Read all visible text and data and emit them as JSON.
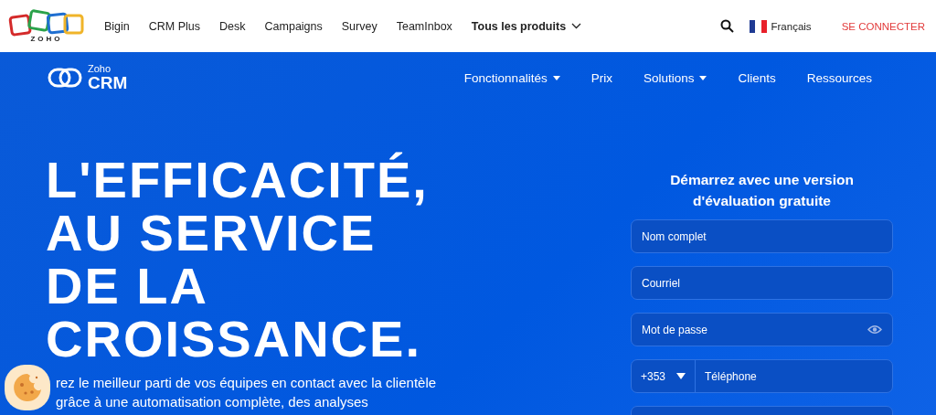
{
  "top_bar": {
    "logo": {
      "wordmark": "ZOHO"
    },
    "products": [
      {
        "label": "Bigin",
        "bold": false,
        "dropdown": false
      },
      {
        "label": "CRM Plus",
        "bold": false,
        "dropdown": false
      },
      {
        "label": "Desk",
        "bold": false,
        "dropdown": false
      },
      {
        "label": "Campaigns",
        "bold": false,
        "dropdown": false
      },
      {
        "label": "Survey",
        "bold": false,
        "dropdown": false
      },
      {
        "label": "TeamInbox",
        "bold": false,
        "dropdown": false
      },
      {
        "label": "Tous les produits",
        "bold": true,
        "dropdown": true
      }
    ],
    "language": "Français",
    "sign_in": "SE CONNECTER"
  },
  "header": {
    "logo": {
      "brand": "Zoho",
      "product": "CRM"
    },
    "menu": [
      {
        "label": "Fonctionnalités",
        "dropdown": true
      },
      {
        "label": "Prix",
        "dropdown": false
      },
      {
        "label": "Solutions",
        "dropdown": true
      },
      {
        "label": "Clients",
        "dropdown": false
      },
      {
        "label": "Ressources",
        "dropdown": false
      }
    ]
  },
  "hero": {
    "headline": [
      "L'EFFICACITÉ,",
      "AU SERVICE",
      "DE LA",
      "CROISSANCE."
    ],
    "lines": [
      "rez le meilleur parti de vos équipes en contact avec la clientèle",
      "grâce à une automatisation complète, des analyses"
    ]
  },
  "signup": {
    "title": "Démarrez avec une version d'évaluation gratuite",
    "fields": [
      {
        "kind": "text",
        "placeholder": "Nom complet"
      },
      {
        "kind": "text",
        "placeholder": "Courriel"
      },
      {
        "kind": "password",
        "placeholder": "Mot de passe"
      },
      {
        "kind": "phone",
        "code": "+353",
        "placeholder": "Téléphone"
      },
      {
        "kind": "empty"
      }
    ]
  }
}
